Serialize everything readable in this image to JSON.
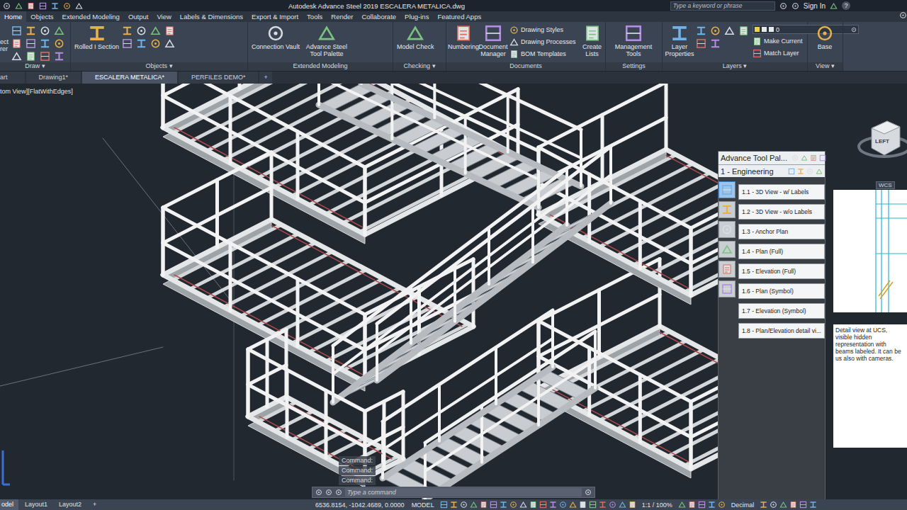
{
  "window": {
    "title": "Autodesk Advance Steel 2019   ESCALERA METALICA.dwg",
    "search_placeholder": "Type a keyword or phrase",
    "sign_in": "Sign In",
    "help": "?"
  },
  "ribbon_tabs": [
    {
      "label": "Home",
      "selected": true
    },
    {
      "label": "Objects",
      "selected": false
    },
    {
      "label": "Extended Modeling",
      "selected": false
    },
    {
      "label": "Output",
      "selected": false
    },
    {
      "label": "View",
      "selected": false
    },
    {
      "label": "Labels & Dimensions",
      "selected": false
    },
    {
      "label": "Export & Import",
      "selected": false
    },
    {
      "label": "Tools",
      "selected": false
    },
    {
      "label": "Render",
      "selected": false
    },
    {
      "label": "Collaborate",
      "selected": false
    },
    {
      "label": "Plug-ins",
      "selected": false
    },
    {
      "label": "Featured Apps",
      "selected": false
    }
  ],
  "ribbon_left_cut": [
    "ect",
    "rer"
  ],
  "ribbon_groups": [
    {
      "label": "Draw",
      "arrow": "▾",
      "buttons": []
    },
    {
      "label": "Objects",
      "arrow": "▾",
      "buttons": [
        {
          "kind": "large",
          "label": "Rolled I Section"
        }
      ]
    },
    {
      "label": "Extended Modeling",
      "arrow": "",
      "buttons": [
        {
          "kind": "large",
          "label": "Connection Vault"
        },
        {
          "kind": "large",
          "label": "Advance Steel Tool Palette"
        }
      ]
    },
    {
      "label": "Checking",
      "arrow": "▾",
      "buttons": [
        {
          "kind": "large",
          "label": "Model Check"
        }
      ]
    },
    {
      "label": "Documents",
      "arrow": "",
      "buttons": [
        {
          "kind": "large",
          "label": "Numbering"
        },
        {
          "kind": "large",
          "label": "Document Manager"
        },
        {
          "kind": "small",
          "label": "Drawing Styles"
        },
        {
          "kind": "small",
          "label": "Drawing Processes"
        },
        {
          "kind": "small",
          "label": "BOM Templates"
        },
        {
          "kind": "large",
          "label": "Create Lists"
        }
      ]
    },
    {
      "label": "Settings",
      "arrow": "",
      "buttons": [
        {
          "kind": "large",
          "label": "Management Tools"
        }
      ]
    },
    {
      "label": "Layers",
      "arrow": "▾",
      "buttons": [
        {
          "kind": "large",
          "label": "Layer Properties"
        },
        {
          "kind": "combo",
          "label": "0"
        },
        {
          "kind": "small",
          "label": "Make Current"
        },
        {
          "kind": "small",
          "label": "Match Layer"
        }
      ]
    },
    {
      "label": "View",
      "arrow": "▾",
      "buttons": [
        {
          "kind": "large",
          "label": "Base"
        }
      ]
    }
  ],
  "doc_tabs": [
    {
      "label": "art",
      "selected": false
    },
    {
      "label": "Drawing1*",
      "selected": false
    },
    {
      "label": "ESCALERA METALICA*",
      "selected": true
    },
    {
      "label": "PERFILES DEMO*",
      "selected": false
    }
  ],
  "doc_tab_add": "+",
  "viewport": {
    "label": "tom View][FlatWithEdges]",
    "viewcube": "LEFT",
    "wcs": "WCS"
  },
  "palette": {
    "title": "Advance Tool Pal...",
    "group": "1 - Engineering",
    "side_tabs": [
      {
        "selected": true
      },
      {
        "selected": false
      },
      {
        "selected": false
      },
      {
        "selected": false
      },
      {
        "selected": false
      },
      {
        "selected": false
      }
    ],
    "items": [
      "1.1 - 3D View - w/ Labels",
      "1.2 - 3D View - w/o Labels",
      "1.3 - Anchor Plan",
      "1.4 - Plan (Full)",
      "1.5 - Elevation (Full)",
      "1.6 - Plan (Symbol)",
      "1.7 - Elevation (Symbol)",
      "1.8 - Plan/Elevation detail vi..."
    ],
    "description": "Detail view at UCS, visible hidden representation with beams labeled. It can be us also with cameras."
  },
  "command": {
    "history": [
      "Command:",
      "Command:",
      "Command:"
    ],
    "placeholder": "Type a command"
  },
  "layout_tabs": [
    {
      "label": "odel",
      "selected": true
    },
    {
      "label": "Layout1",
      "selected": false
    },
    {
      "label": "Layout2",
      "selected": false
    }
  ],
  "layout_add": "+",
  "status_bar": {
    "coords": "6536.8154, -1042.4689, 0.0000",
    "space": "MODEL",
    "scale": "1:1 / 100%",
    "units": "Decimal"
  }
}
